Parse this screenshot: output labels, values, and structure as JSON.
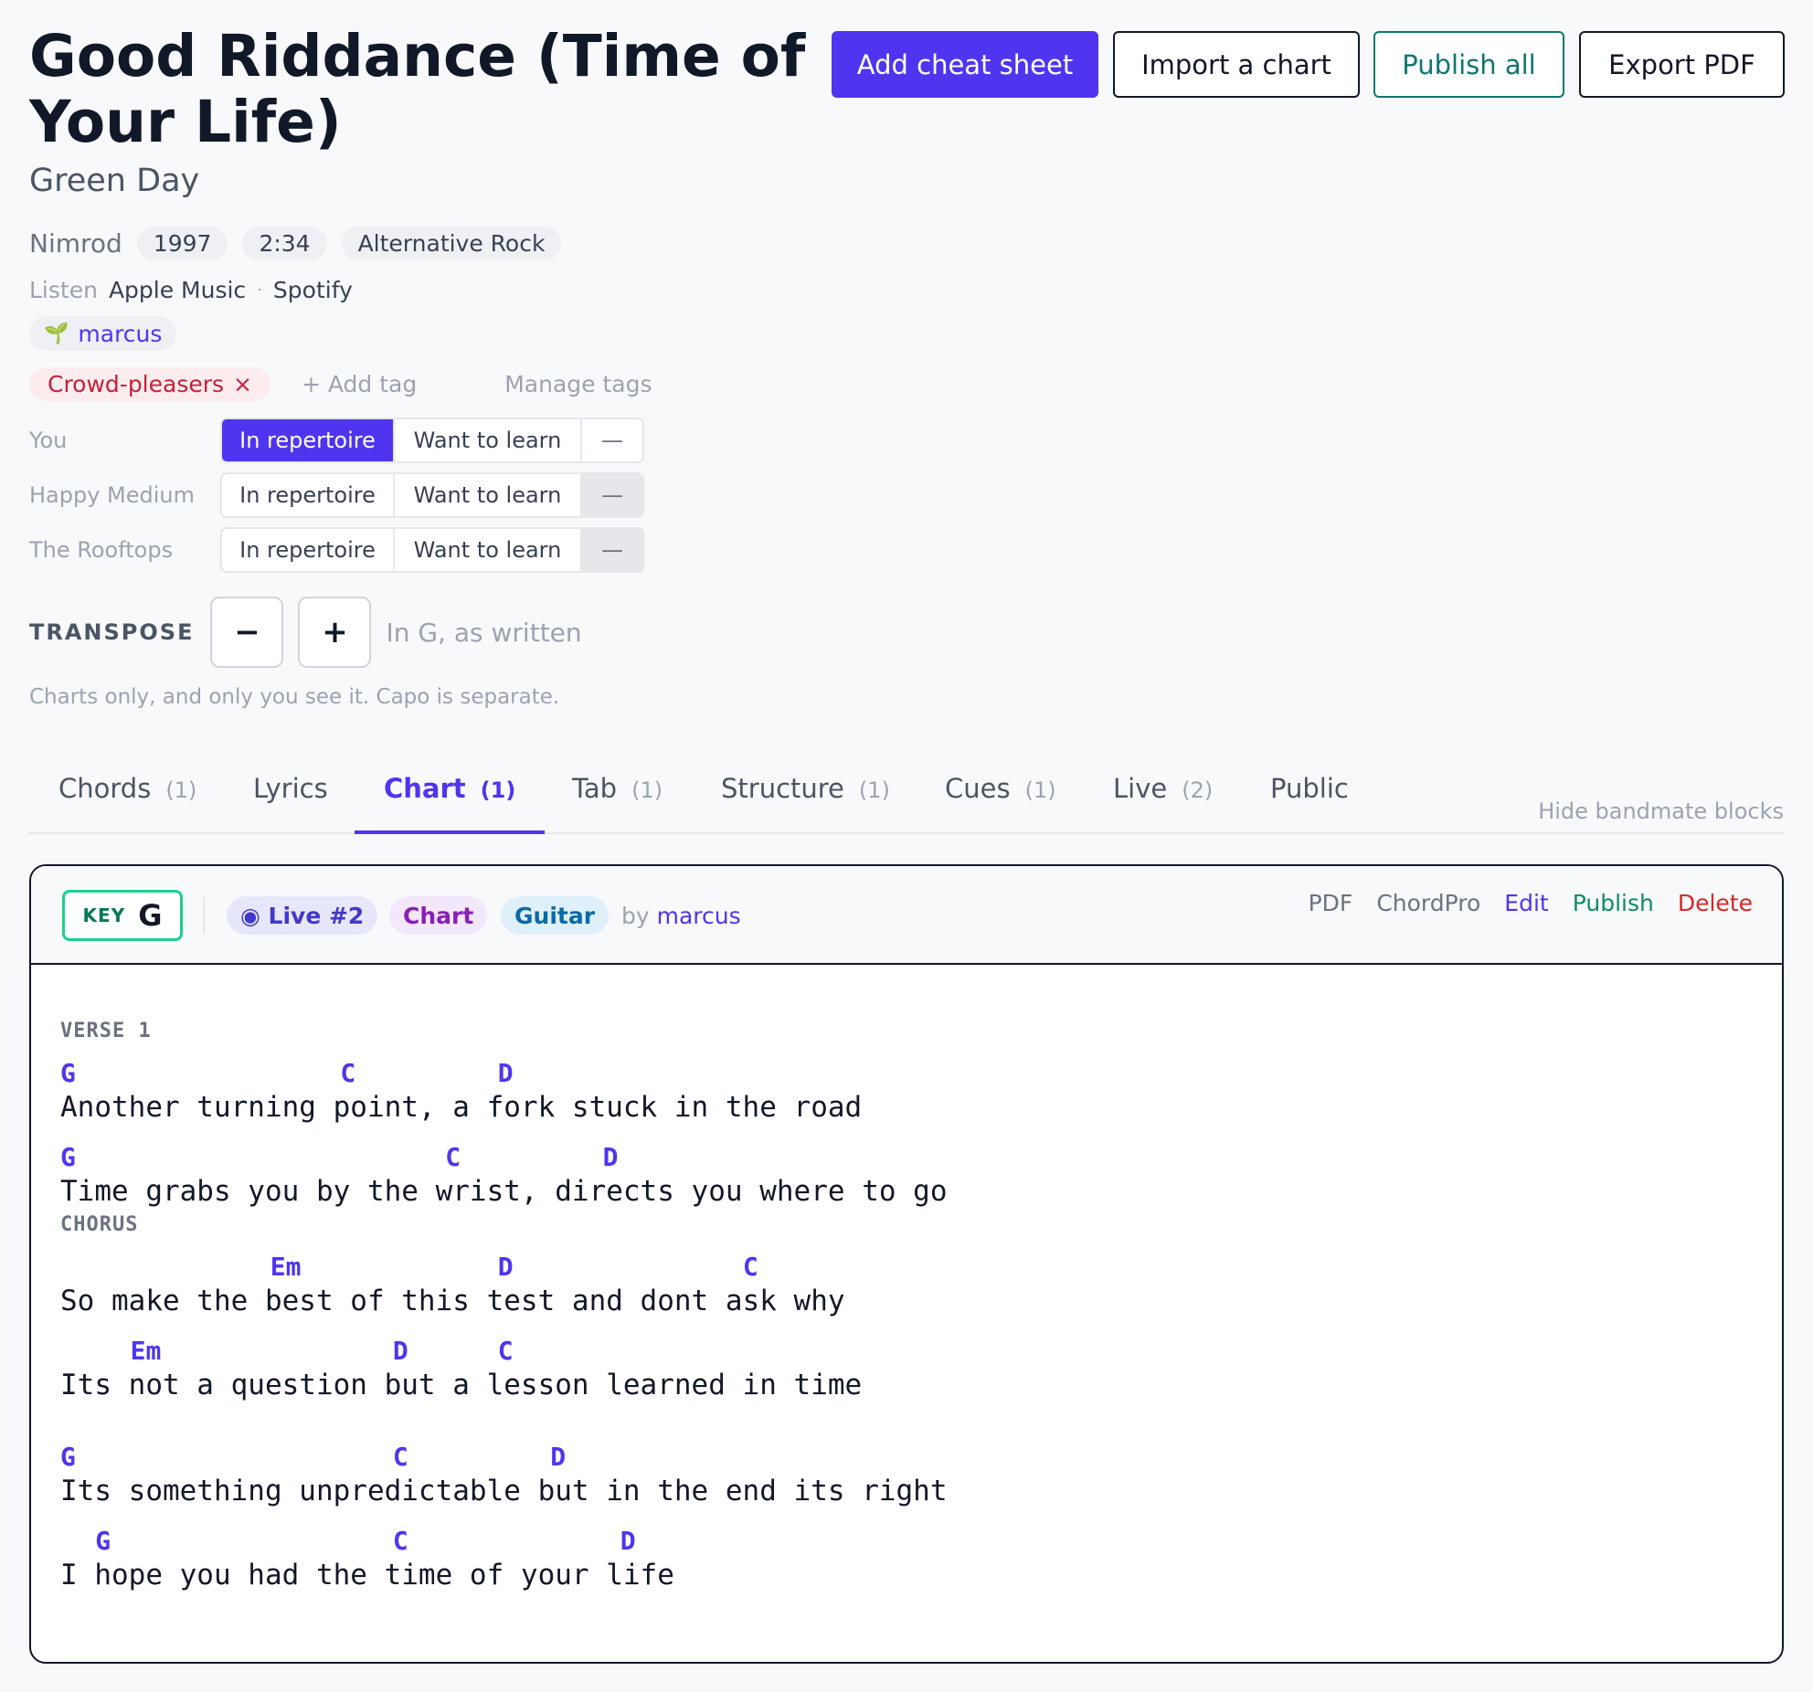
{
  "song": {
    "title": "Good Riddance (Time of Your Life)",
    "artist": "Green Day",
    "album": "Nimrod",
    "year": "1997",
    "duration": "2:34",
    "genre": "Alternative Rock"
  },
  "toolbar": {
    "add_cheat_sheet": "Add cheat sheet",
    "import_chart": "Import a chart",
    "publish_all": "Publish all",
    "export_pdf": "Export PDF"
  },
  "listen": {
    "label": "Listen",
    "apple": "Apple Music",
    "sep": "·",
    "spotify": "Spotify"
  },
  "user": {
    "icon": "sprout-icon",
    "name": "marcus"
  },
  "tags": {
    "items": [
      "Crowd-pleasers"
    ],
    "remove": "×",
    "add": "+ Add tag",
    "manage": "Manage tags"
  },
  "status_rows": [
    {
      "label": "You",
      "opt1": "In repertoire",
      "opt2": "Want to learn",
      "opt3": "—",
      "selected": "In repertoire"
    },
    {
      "label": "Happy Medium",
      "opt1": "In repertoire",
      "opt2": "Want to learn",
      "opt3": "—",
      "selected": "—"
    },
    {
      "label": "The Rooftops",
      "opt1": "In repertoire",
      "opt2": "Want to learn",
      "opt3": "—",
      "selected": "—"
    }
  ],
  "transpose": {
    "label": "TRANSPOSE",
    "minus": "−",
    "plus": "+",
    "status": "In G, as written",
    "note": "Charts only, and only you see it. Capo is separate."
  },
  "tabs": [
    {
      "label": "Chords",
      "count": "(1)"
    },
    {
      "label": "Lyrics",
      "count": ""
    },
    {
      "label": "Chart",
      "count": "(1)",
      "active": true
    },
    {
      "label": "Tab",
      "count": "(1)"
    },
    {
      "label": "Structure",
      "count": "(1)"
    },
    {
      "label": "Cues",
      "count": "(1)"
    },
    {
      "label": "Live",
      "count": "(2)"
    },
    {
      "label": "Public",
      "count": ""
    }
  ],
  "hide_bandmate": "Hide bandmate blocks",
  "block": {
    "key_label": "KEY",
    "key_value": "G",
    "live_badge": "◉ Live #2",
    "type_badge": "Chart",
    "instrument_badge": "Guitar",
    "by_prefix": "by",
    "author": "marcus",
    "actions": {
      "pdf": "PDF",
      "chordpro": "ChordPro",
      "edit": "Edit",
      "publish": "Publish",
      "delete": "Delete"
    }
  },
  "chart": {
    "sections": [
      {
        "name": "VERSE 1",
        "lines": [
          {
            "lyric": "Another turning point, a fork stuck in the road",
            "chords": [
              {
                "c": "G",
                "pos": 0
              },
              {
                "c": "C",
                "pos": 16
              },
              {
                "c": "D",
                "pos": 25
              }
            ]
          },
          {
            "lyric": "Time grabs you by the wrist, directs you where to go",
            "chords": [
              {
                "c": "G",
                "pos": 0
              },
              {
                "c": "C",
                "pos": 22
              },
              {
                "c": "D",
                "pos": 31
              }
            ]
          }
        ]
      },
      {
        "name": "CHORUS",
        "lines": [
          {
            "lyric": "So make the best of this test and dont ask why",
            "chords": [
              {
                "c": "Em",
                "pos": 12
              },
              {
                "c": "D",
                "pos": 25
              },
              {
                "c": "C",
                "pos": 39
              }
            ]
          },
          {
            "lyric": "Its not a question but a lesson learned in time",
            "chords": [
              {
                "c": "Em",
                "pos": 4
              },
              {
                "c": "D",
                "pos": 19
              },
              {
                "c": "C",
                "pos": 25
              }
            ]
          },
          {
            "lyric": "Its something unpredictable but in the end its right",
            "chords": [
              {
                "c": "G",
                "pos": 0
              },
              {
                "c": "C",
                "pos": 19
              },
              {
                "c": "D",
                "pos": 28
              }
            ]
          },
          {
            "lyric": "I hope you had the time of your life",
            "chords": [
              {
                "c": "G",
                "pos": 2
              },
              {
                "c": "C",
                "pos": 19
              },
              {
                "c": "D",
                "pos": 32
              }
            ]
          }
        ]
      }
    ]
  }
}
